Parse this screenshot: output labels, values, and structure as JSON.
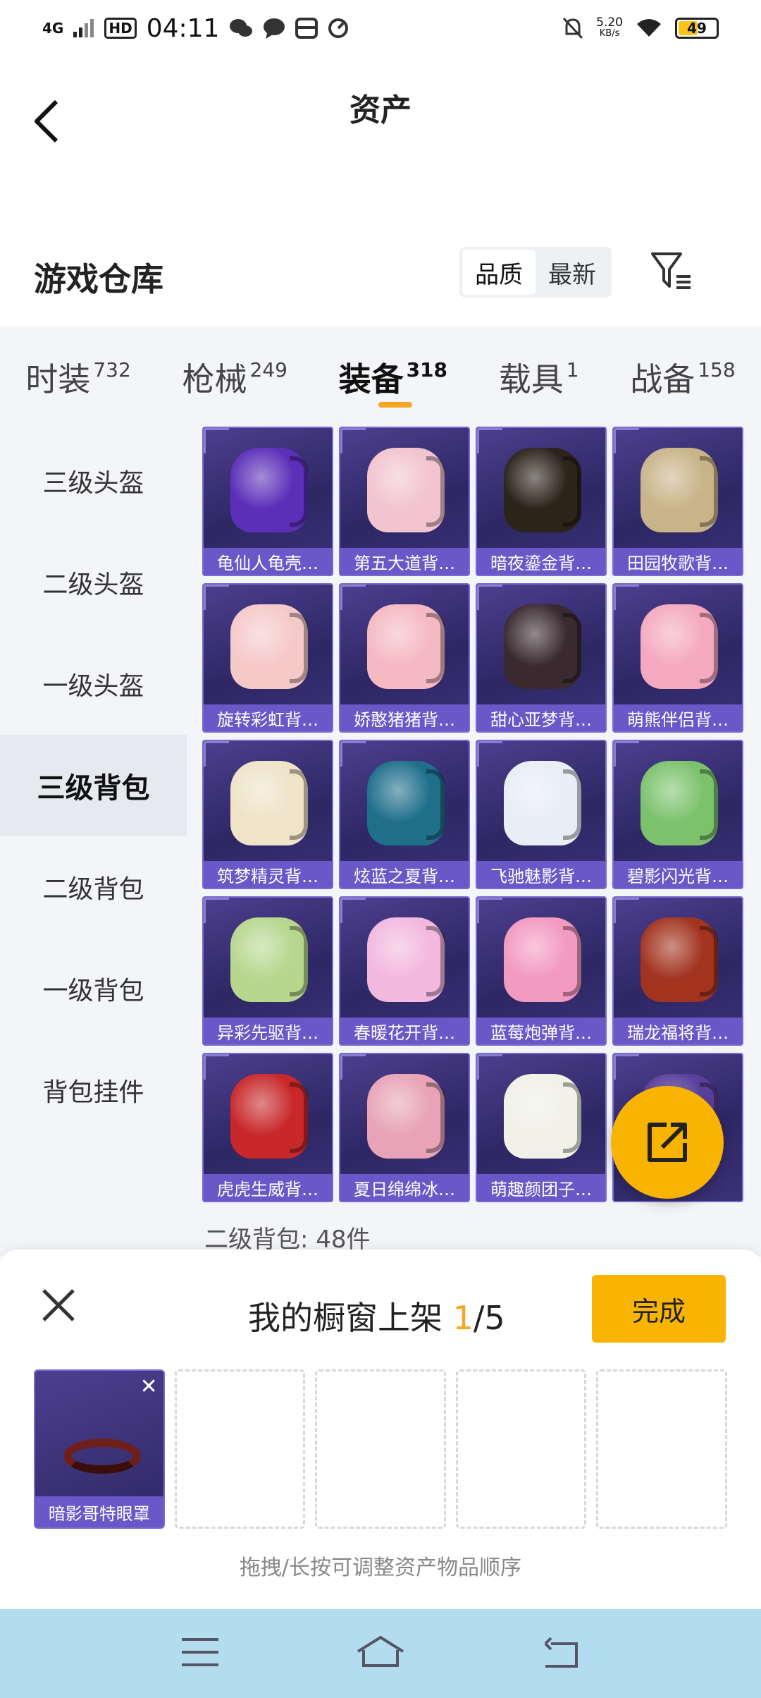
{
  "status_bar": {
    "network": "4G",
    "hd": "HD",
    "time": "04:11",
    "speed_value": "5.20",
    "speed_unit": "KB/s",
    "battery": "49"
  },
  "header": {
    "title": "资产"
  },
  "section": {
    "title": "游戏仓库",
    "sort_options": [
      "品质",
      "最新"
    ],
    "sort_selected": "品质"
  },
  "tabs": [
    {
      "label": "时装",
      "count": "732"
    },
    {
      "label": "枪械",
      "count": "249"
    },
    {
      "label": "装备",
      "count": "318"
    },
    {
      "label": "载具",
      "count": "1"
    },
    {
      "label": "战备",
      "count": "158"
    }
  ],
  "sidebar": {
    "items": [
      "三级头盔",
      "二级头盔",
      "一级头盔",
      "三级背包",
      "二级背包",
      "一级背包",
      "背包挂件"
    ],
    "selected": "三级背包"
  },
  "items": [
    {
      "label": "龟仙人龟壳…",
      "color": "#5b2fb8"
    },
    {
      "label": "第五大道背…",
      "color": "#f2c4cf"
    },
    {
      "label": "暗夜鎏金背…",
      "color": "#2a2419"
    },
    {
      "label": "田园牧歌背…",
      "color": "#c9b48a"
    },
    {
      "label": "旋转彩虹背…",
      "color": "#f6c9c9"
    },
    {
      "label": "娇憨猪猪背…",
      "color": "#f5b9c2"
    },
    {
      "label": "甜心亚梦背…",
      "color": "#3a2a30"
    },
    {
      "label": "萌熊伴侣背…",
      "color": "#f4a9bf"
    },
    {
      "label": "筑梦精灵背…",
      "color": "#efe3c8"
    },
    {
      "label": "炫蓝之夏背…",
      "color": "#1f6f8b"
    },
    {
      "label": "飞驰魅影背…",
      "color": "#e8eef5"
    },
    {
      "label": "碧影闪光背…",
      "color": "#7cc26d"
    },
    {
      "label": "异彩先驱背…",
      "color": "#b7d78f"
    },
    {
      "label": "春暖花开背…",
      "color": "#f3b8de"
    },
    {
      "label": "蓝莓炮弹背…",
      "color": "#f29abf"
    },
    {
      "label": "瑞龙福将背…",
      "color": "#a2331f"
    },
    {
      "label": "虎虎生威背…",
      "color": "#c8282a"
    },
    {
      "label": "夏日绵绵冰…",
      "color": "#e8a3b8"
    },
    {
      "label": "萌趣颜团子…",
      "color": "#f1f1e8"
    },
    {
      "label": "",
      "color": "#5a3f9c"
    }
  ],
  "item_count_text": "二级背包: 48件",
  "showcase": {
    "title_prefix": "我的橱窗上架 ",
    "current": "1",
    "total_suffix": "/5",
    "done_label": "完成",
    "slot_item_label": "暗影哥特眼罩",
    "remove_glyph": "✕",
    "hint": "拖拽/长按可调整资产物品顺序"
  }
}
